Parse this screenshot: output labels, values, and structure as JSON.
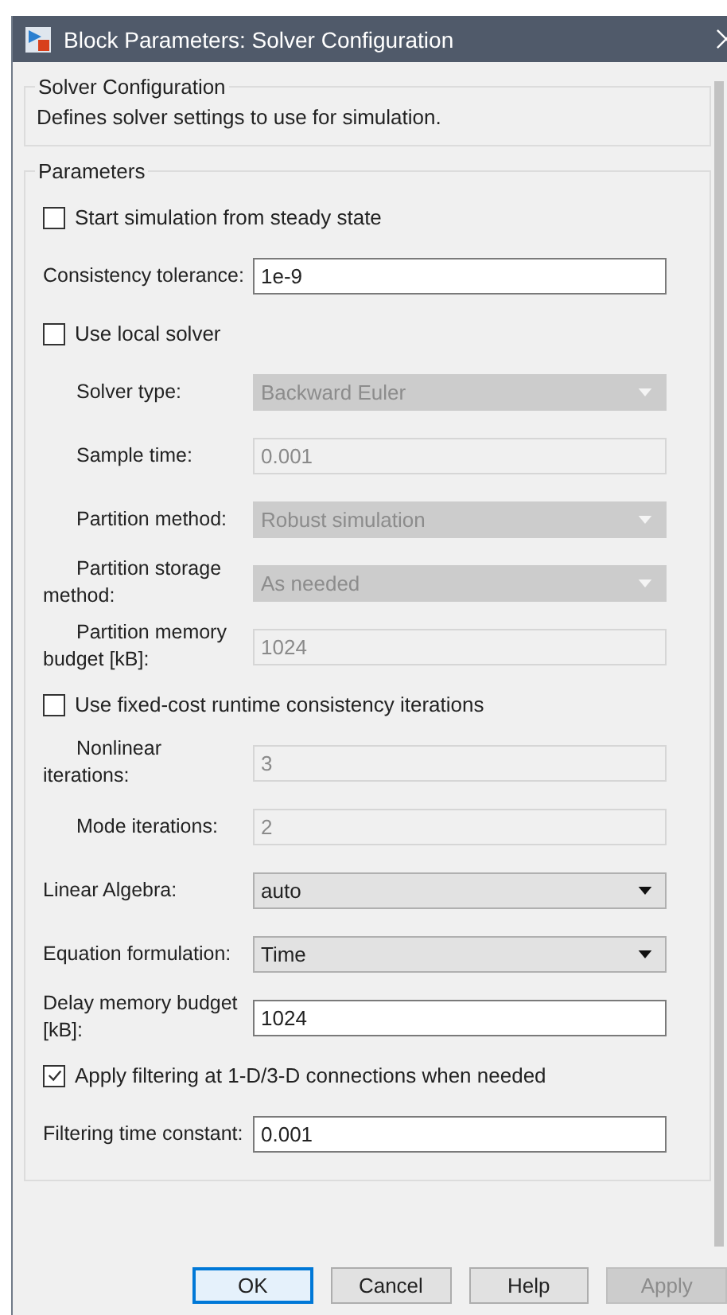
{
  "window": {
    "title": "Block Parameters: Solver Configuration"
  },
  "description_group": {
    "title": "Solver Configuration",
    "text": "Defines solver settings to use for simulation."
  },
  "parameters_group": {
    "title": "Parameters",
    "rows": [
      {
        "kind": "checkbox",
        "label": "Start simulation from steady state",
        "checked": false
      },
      {
        "kind": "edit",
        "label": "Consistency tolerance:",
        "value": "1e-9",
        "disabled": false,
        "indented": false
      },
      {
        "kind": "checkbox",
        "label": "Use local solver",
        "checked": false
      },
      {
        "kind": "dropdown",
        "label": "Solver type:",
        "value": "Backward Euler",
        "disabled": true,
        "indented": true
      },
      {
        "kind": "edit",
        "label": "Sample time:",
        "value": "0.001",
        "disabled": true,
        "indented": true
      },
      {
        "kind": "dropdown",
        "label": "Partition method:",
        "value": "Robust simulation",
        "disabled": true,
        "indented": true
      },
      {
        "kind": "dropdown",
        "label": "Partition storage method:",
        "value": "As needed",
        "disabled": true,
        "indented": true
      },
      {
        "kind": "edit",
        "label": "Partition memory budget [kB]:",
        "value": "1024",
        "disabled": true,
        "indented": true
      },
      {
        "kind": "checkbox",
        "label": "Use fixed-cost runtime consistency iterations",
        "checked": false
      },
      {
        "kind": "edit",
        "label": "Nonlinear iterations:",
        "value": "3",
        "disabled": true,
        "indented": true
      },
      {
        "kind": "edit",
        "label": "Mode iterations:",
        "value": "2",
        "disabled": true,
        "indented": true
      },
      {
        "kind": "dropdown",
        "label": "Linear Algebra:",
        "value": "auto",
        "disabled": false,
        "indented": false
      },
      {
        "kind": "dropdown",
        "label": "Equation formulation:",
        "value": "Time",
        "disabled": false,
        "indented": false
      },
      {
        "kind": "edit",
        "label": "Delay memory budget [kB]:",
        "value": "1024",
        "disabled": false,
        "indented": false
      },
      {
        "kind": "checkbox",
        "label": "Apply filtering at 1-D/3-D connections when needed",
        "checked": true
      },
      {
        "kind": "edit",
        "label": "Filtering time constant:",
        "value": "0.001",
        "disabled": false,
        "indented": false
      }
    ]
  },
  "buttons": [
    {
      "label": "OK",
      "default": true,
      "disabled": false
    },
    {
      "label": "Cancel",
      "default": false,
      "disabled": false
    },
    {
      "label": "Help",
      "default": false,
      "disabled": false
    },
    {
      "label": "Apply",
      "default": false,
      "disabled": true
    }
  ]
}
